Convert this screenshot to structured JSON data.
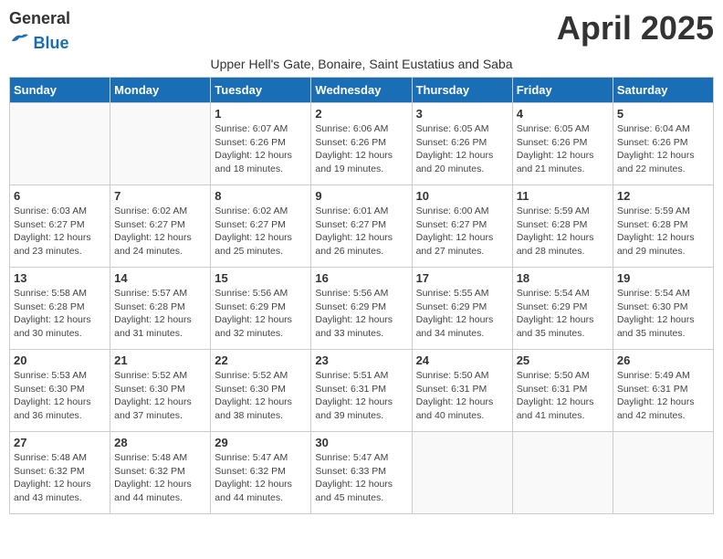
{
  "header": {
    "logo_general": "General",
    "logo_blue": "Blue",
    "title": "April 2025",
    "subtitle": "Upper Hell's Gate, Bonaire, Saint Eustatius and Saba"
  },
  "weekdays": [
    "Sunday",
    "Monday",
    "Tuesday",
    "Wednesday",
    "Thursday",
    "Friday",
    "Saturday"
  ],
  "weeks": [
    [
      {
        "day": "",
        "info": ""
      },
      {
        "day": "",
        "info": ""
      },
      {
        "day": "1",
        "info": "Sunrise: 6:07 AM\nSunset: 6:26 PM\nDaylight: 12 hours and 18 minutes."
      },
      {
        "day": "2",
        "info": "Sunrise: 6:06 AM\nSunset: 6:26 PM\nDaylight: 12 hours and 19 minutes."
      },
      {
        "day": "3",
        "info": "Sunrise: 6:05 AM\nSunset: 6:26 PM\nDaylight: 12 hours and 20 minutes."
      },
      {
        "day": "4",
        "info": "Sunrise: 6:05 AM\nSunset: 6:26 PM\nDaylight: 12 hours and 21 minutes."
      },
      {
        "day": "5",
        "info": "Sunrise: 6:04 AM\nSunset: 6:26 PM\nDaylight: 12 hours and 22 minutes."
      }
    ],
    [
      {
        "day": "6",
        "info": "Sunrise: 6:03 AM\nSunset: 6:27 PM\nDaylight: 12 hours and 23 minutes."
      },
      {
        "day": "7",
        "info": "Sunrise: 6:02 AM\nSunset: 6:27 PM\nDaylight: 12 hours and 24 minutes."
      },
      {
        "day": "8",
        "info": "Sunrise: 6:02 AM\nSunset: 6:27 PM\nDaylight: 12 hours and 25 minutes."
      },
      {
        "day": "9",
        "info": "Sunrise: 6:01 AM\nSunset: 6:27 PM\nDaylight: 12 hours and 26 minutes."
      },
      {
        "day": "10",
        "info": "Sunrise: 6:00 AM\nSunset: 6:27 PM\nDaylight: 12 hours and 27 minutes."
      },
      {
        "day": "11",
        "info": "Sunrise: 5:59 AM\nSunset: 6:28 PM\nDaylight: 12 hours and 28 minutes."
      },
      {
        "day": "12",
        "info": "Sunrise: 5:59 AM\nSunset: 6:28 PM\nDaylight: 12 hours and 29 minutes."
      }
    ],
    [
      {
        "day": "13",
        "info": "Sunrise: 5:58 AM\nSunset: 6:28 PM\nDaylight: 12 hours and 30 minutes."
      },
      {
        "day": "14",
        "info": "Sunrise: 5:57 AM\nSunset: 6:28 PM\nDaylight: 12 hours and 31 minutes."
      },
      {
        "day": "15",
        "info": "Sunrise: 5:56 AM\nSunset: 6:29 PM\nDaylight: 12 hours and 32 minutes."
      },
      {
        "day": "16",
        "info": "Sunrise: 5:56 AM\nSunset: 6:29 PM\nDaylight: 12 hours and 33 minutes."
      },
      {
        "day": "17",
        "info": "Sunrise: 5:55 AM\nSunset: 6:29 PM\nDaylight: 12 hours and 34 minutes."
      },
      {
        "day": "18",
        "info": "Sunrise: 5:54 AM\nSunset: 6:29 PM\nDaylight: 12 hours and 35 minutes."
      },
      {
        "day": "19",
        "info": "Sunrise: 5:54 AM\nSunset: 6:30 PM\nDaylight: 12 hours and 35 minutes."
      }
    ],
    [
      {
        "day": "20",
        "info": "Sunrise: 5:53 AM\nSunset: 6:30 PM\nDaylight: 12 hours and 36 minutes."
      },
      {
        "day": "21",
        "info": "Sunrise: 5:52 AM\nSunset: 6:30 PM\nDaylight: 12 hours and 37 minutes."
      },
      {
        "day": "22",
        "info": "Sunrise: 5:52 AM\nSunset: 6:30 PM\nDaylight: 12 hours and 38 minutes."
      },
      {
        "day": "23",
        "info": "Sunrise: 5:51 AM\nSunset: 6:31 PM\nDaylight: 12 hours and 39 minutes."
      },
      {
        "day": "24",
        "info": "Sunrise: 5:50 AM\nSunset: 6:31 PM\nDaylight: 12 hours and 40 minutes."
      },
      {
        "day": "25",
        "info": "Sunrise: 5:50 AM\nSunset: 6:31 PM\nDaylight: 12 hours and 41 minutes."
      },
      {
        "day": "26",
        "info": "Sunrise: 5:49 AM\nSunset: 6:31 PM\nDaylight: 12 hours and 42 minutes."
      }
    ],
    [
      {
        "day": "27",
        "info": "Sunrise: 5:48 AM\nSunset: 6:32 PM\nDaylight: 12 hours and 43 minutes."
      },
      {
        "day": "28",
        "info": "Sunrise: 5:48 AM\nSunset: 6:32 PM\nDaylight: 12 hours and 44 minutes."
      },
      {
        "day": "29",
        "info": "Sunrise: 5:47 AM\nSunset: 6:32 PM\nDaylight: 12 hours and 44 minutes."
      },
      {
        "day": "30",
        "info": "Sunrise: 5:47 AM\nSunset: 6:33 PM\nDaylight: 12 hours and 45 minutes."
      },
      {
        "day": "",
        "info": ""
      },
      {
        "day": "",
        "info": ""
      },
      {
        "day": "",
        "info": ""
      }
    ]
  ]
}
